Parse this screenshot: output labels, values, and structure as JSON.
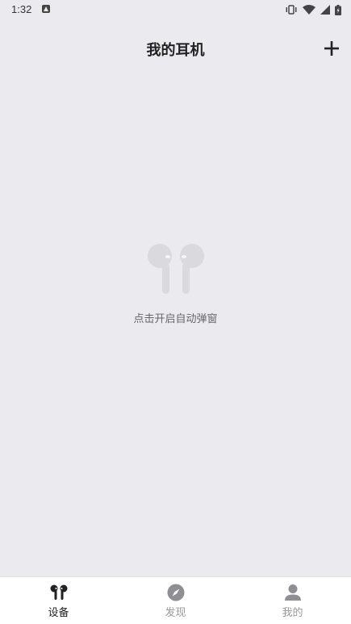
{
  "status_bar": {
    "time": "1:32",
    "icons": [
      "notification-icon",
      "vibrate-icon",
      "wifi-icon",
      "signal-icon",
      "battery-charging-icon"
    ]
  },
  "header": {
    "title": "我的耳机",
    "add_icon": "plus-icon"
  },
  "empty_state": {
    "icon": "earbuds-icon",
    "text": "点击开启自动弹窗"
  },
  "bottom_nav": {
    "items": [
      {
        "label": "设备",
        "icon": "earbuds-icon",
        "active": true
      },
      {
        "label": "发现",
        "icon": "compass-icon",
        "active": false
      },
      {
        "label": "我的",
        "icon": "person-icon",
        "active": false
      }
    ]
  },
  "colors": {
    "background": "#ebebef",
    "nav_background": "#ffffff",
    "active_label": "#222222",
    "inactive_label": "#999999",
    "empty_icon": "#d9d9de"
  }
}
